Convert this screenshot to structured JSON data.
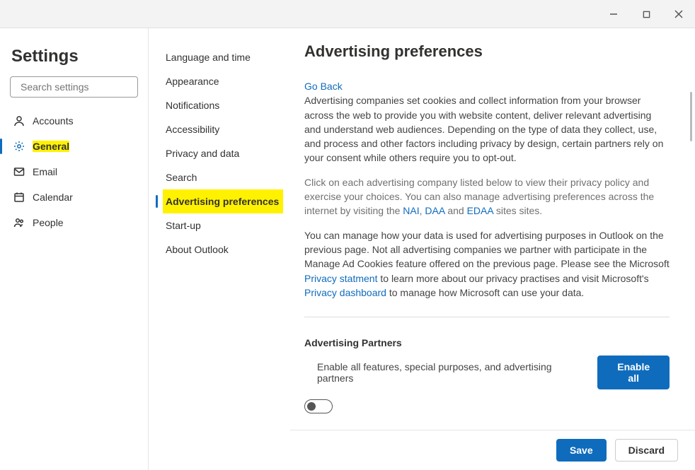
{
  "window": {
    "minimize": "—",
    "maximize": "□",
    "close": "✕"
  },
  "settings_title": "Settings",
  "search": {
    "placeholder": "Search settings"
  },
  "nav": {
    "accounts": "Accounts",
    "general": "General",
    "email": "Email",
    "calendar": "Calendar",
    "people": "People"
  },
  "subnav": {
    "language": "Language and time",
    "appearance": "Appearance",
    "notifications": "Notifications",
    "accessibility": "Accessibility",
    "privacy": "Privacy and data",
    "search": "Search",
    "advertising": "Advertising preferences",
    "startup": "Start-up",
    "about": "About Outlook"
  },
  "content": {
    "title": "Advertising preferences",
    "go_back": "Go Back",
    "para1": "Advertising companies set cookies and collect information from your browser across the web to provide you with website content, deliver relevant advertising and understand web audiences. Depending on the type of data they collect, use, and process and other factors including privacy by design, certain partners rely on your consent while others require you to opt-out.",
    "para2_a": "Click on each advertising company listed below to view their privacy policy and exercise your choices. You can also manage advertising preferences across the internet by visiting the ",
    "para2_links": {
      "nai": "NAI",
      "daa": "DAA",
      "edaa": "EDAA"
    },
    "para2_b": " sites sites.",
    "para3_a": "You can manage how your data is used for advertising purposes in Outlook on the previous page. Not all advertising companies we partner with participate in the Manage Ad Cookies feature offered on the previous page. Please see the Microsoft ",
    "para3_link1": "Privacy statment",
    "para3_b": " to learn more about our privacy practises and visit Microsoft's ",
    "para3_link2": "Privacy dashboard",
    "para3_c": " to manage how Microsoft can use your data.",
    "partners_title": "Advertising Partners",
    "partners_desc": "Enable all features, special purposes, and advertising partners",
    "enable_all": "Enable all"
  },
  "footer": {
    "save": "Save",
    "discard": "Discard"
  }
}
